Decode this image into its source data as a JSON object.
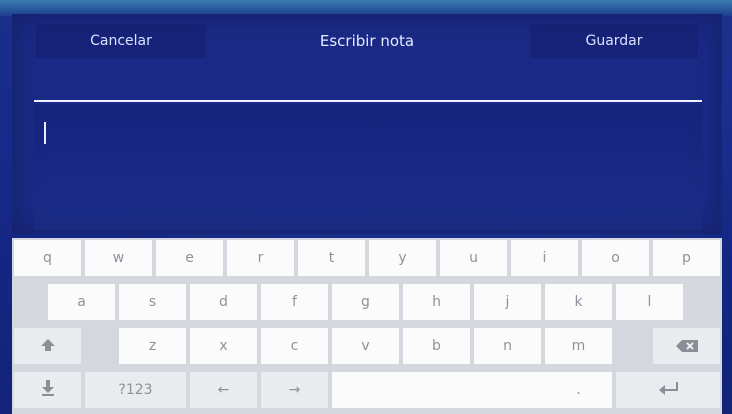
{
  "header": {
    "cancel_label": "Cancelar",
    "title": "Escribir nota",
    "save_label": "Guardar"
  },
  "keyboard": {
    "row1": [
      "q",
      "w",
      "e",
      "r",
      "t",
      "y",
      "u",
      "i",
      "o",
      "p"
    ],
    "row2": [
      "a",
      "s",
      "d",
      "f",
      "g",
      "h",
      "j",
      "k",
      "l"
    ],
    "row3": [
      "z",
      "x",
      "c",
      "v",
      "b",
      "n",
      "m"
    ],
    "row4": {
      "symbols": "?123",
      "left_arrow": "←",
      "right_arrow": "→",
      "period": "."
    },
    "icons": {
      "shift": "shift-icon",
      "backspace": "backspace-icon",
      "hide_keyboard": "hide-keyboard-icon",
      "enter": "enter-icon"
    }
  },
  "colors": {
    "background": "#17298a",
    "keyboard": "#d4d8de",
    "key": "#fbfbfc"
  }
}
